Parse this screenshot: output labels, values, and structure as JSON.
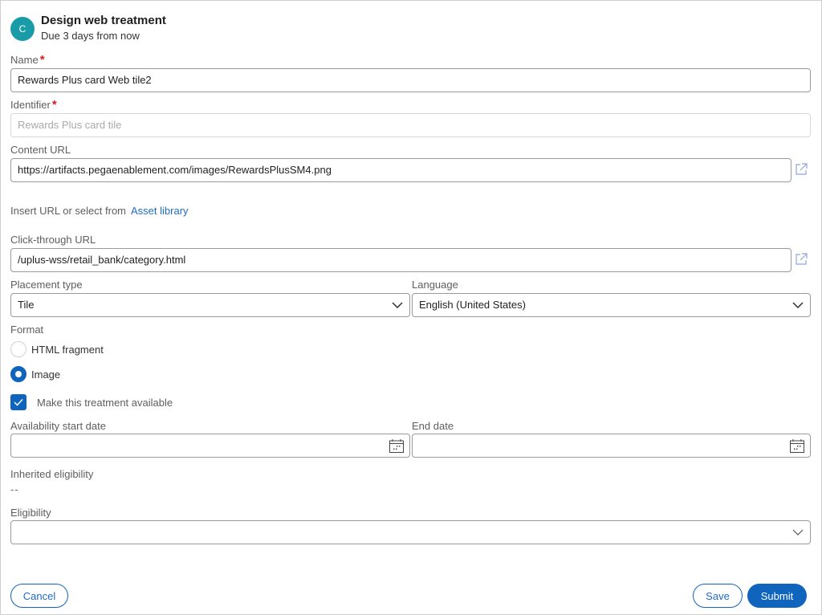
{
  "header": {
    "avatar_letter": "C",
    "title": "Design web treatment",
    "subtitle": "Due 3 days from now"
  },
  "form": {
    "name": {
      "label": "Name",
      "required_mark": "*",
      "value": "Rewards Plus card Web tile2"
    },
    "identifier": {
      "label": "Identifier",
      "required_mark": "*",
      "value": "Rewards Plus card tile"
    },
    "content_url": {
      "label": "Content URL",
      "value": "https://artifacts.pegaenablement.com/images/RewardsPlusSM4.png"
    },
    "insert_hint": {
      "text": "Insert URL or select from",
      "link": "Asset library"
    },
    "click_through_url": {
      "label": "Click-through URL",
      "value": "/uplus-wss/retail_bank/category.html"
    },
    "placement_type": {
      "label": "Placement type",
      "value": "Tile"
    },
    "language": {
      "label": "Language",
      "value": "English (United States)"
    },
    "format": {
      "label": "Format",
      "options": [
        {
          "label": "HTML fragment",
          "selected": false
        },
        {
          "label": "Image",
          "selected": true
        }
      ]
    },
    "availability_checkbox": {
      "label": "Make this treatment available",
      "checked": true
    },
    "availability_start_date": {
      "label": "Availability start date",
      "value": ""
    },
    "end_date": {
      "label": "End date",
      "value": ""
    },
    "inherited_eligibility": {
      "label": "Inherited eligibility",
      "value": "--"
    },
    "eligibility": {
      "label": "Eligibility",
      "value": ""
    }
  },
  "actions": {
    "cancel": "Cancel",
    "save": "Save",
    "submit": "Submit"
  },
  "colors": {
    "accent": "#0f64be",
    "avatar": "#1a9ba8",
    "required": "#d21f1f"
  }
}
